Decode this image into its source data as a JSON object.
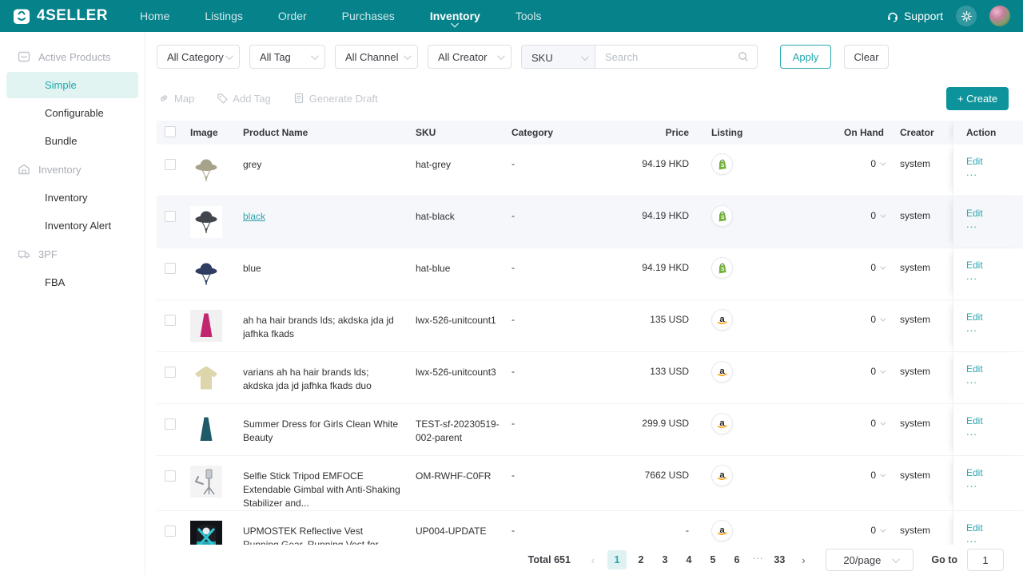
{
  "colors": {
    "brand_teal": "#06828b",
    "accent_teal": "#0c939b",
    "link_teal": "#2ba5ad",
    "active_bg": "#e2f4f2",
    "shopify_green": "#74b03c",
    "amazon_orange": "#ff9900"
  },
  "nav": {
    "brand": "4SELLER",
    "items": [
      {
        "label": "Home",
        "active": false
      },
      {
        "label": "Listings",
        "active": false
      },
      {
        "label": "Order",
        "active": false
      },
      {
        "label": "Purchases",
        "active": false
      },
      {
        "label": "Inventory",
        "active": true
      },
      {
        "label": "Tools",
        "active": false
      }
    ],
    "support": "Support"
  },
  "sidebar": {
    "sections": [
      {
        "label": "Active Products",
        "icon": "products-box-icon",
        "items": [
          {
            "label": "Simple",
            "active": true
          },
          {
            "label": "Configurable",
            "active": false
          },
          {
            "label": "Bundle",
            "active": false
          }
        ]
      },
      {
        "label": "Inventory",
        "icon": "warehouse-icon",
        "items": [
          {
            "label": "Inventory",
            "active": false
          },
          {
            "label": "Inventory Alert",
            "active": false
          }
        ]
      },
      {
        "label": "3PF",
        "icon": "fulfillment-truck-icon",
        "items": [
          {
            "label": "FBA",
            "active": false
          }
        ]
      }
    ]
  },
  "filters": {
    "category": "All Category",
    "tag": "All Tag",
    "channel": "All Channel",
    "creator": "All Creator",
    "search_field": "SKU",
    "search_placeholder": "Search",
    "apply": "Apply",
    "clear": "Clear"
  },
  "toolbar": {
    "map": "Map",
    "add_tag": "Add Tag",
    "generate_draft": "Generate Draft",
    "create": "+ Create"
  },
  "table": {
    "columns": {
      "image": "Image",
      "name": "Product Name",
      "sku": "SKU",
      "category": "Category",
      "price": "Price",
      "listing": "Listing",
      "on_hand": "On Hand",
      "creator": "Creator",
      "action": "Action"
    },
    "rows": [
      {
        "name": "grey",
        "name_link": false,
        "highlight": false,
        "sku": "hat-grey",
        "category": "-",
        "price": "94.19 HKD",
        "listing": "shopify",
        "on_hand": "0",
        "creator": "system",
        "action_edit": "Edit",
        "action_more": "...",
        "thumb": {
          "type": "hat",
          "color": "#a7a38a",
          "bg": "#ffffff"
        }
      },
      {
        "name": "black",
        "name_link": true,
        "highlight": true,
        "sku": "hat-black",
        "category": "-",
        "price": "94.19 HKD",
        "listing": "shopify",
        "on_hand": "0",
        "creator": "system",
        "action_edit": "Edit",
        "action_more": "...",
        "thumb": {
          "type": "hat",
          "color": "#41464c",
          "bg": "#ffffff"
        }
      },
      {
        "name": "blue",
        "name_link": false,
        "highlight": false,
        "sku": "hat-blue",
        "category": "-",
        "price": "94.19 HKD",
        "listing": "shopify",
        "on_hand": "0",
        "creator": "system",
        "action_edit": "Edit",
        "action_more": "...",
        "thumb": {
          "type": "hat",
          "color": "#2f3d63",
          "bg": "#ffffff"
        }
      },
      {
        "name": "ah ha hair brands lds; akdska jda jd jafhka fkads",
        "name_link": false,
        "highlight": false,
        "sku": "lwx-526-unitcount1",
        "category": "-",
        "price": "135 USD",
        "listing": "amazon",
        "on_hand": "0",
        "creator": "system",
        "action_edit": "Edit",
        "action_more": "...",
        "thumb": {
          "type": "dress",
          "color": "#c2266f",
          "bg": "#f1f1f1"
        }
      },
      {
        "name": "varians ah ha hair brands lds; akdska jda jd jafhka fkads duo",
        "name_link": false,
        "highlight": false,
        "sku": "lwx-526-unitcount3",
        "category": "-",
        "price": "133 USD",
        "listing": "amazon",
        "on_hand": "0",
        "creator": "system",
        "action_edit": "Edit",
        "action_more": "...",
        "thumb": {
          "type": "shirt",
          "color": "#ddd6ad",
          "bg": "#ffffff"
        }
      },
      {
        "name": "Summer Dress for Girls Clean White Beauty",
        "name_link": false,
        "highlight": false,
        "sku": "TEST-sf-20230519-002-parent",
        "category": "-",
        "price": "299.9 USD",
        "listing": "amazon",
        "on_hand": "0",
        "creator": "system",
        "action_edit": "Edit",
        "action_more": "...",
        "thumb": {
          "type": "dress",
          "color": "#1e5a68",
          "bg": "#ffffff"
        }
      },
      {
        "name": "Selfie Stick Tripod EMFOCE Extendable Gimbal with Anti-Shaking Stabilizer and...",
        "name_link": false,
        "highlight": false,
        "sku": "OM-RWHF-C0FR",
        "category": "-",
        "price": "7662 USD",
        "listing": "amazon",
        "on_hand": "0",
        "creator": "system",
        "action_edit": "Edit",
        "action_more": "...",
        "thumb": {
          "type": "selfie",
          "color": "#8d939a",
          "bg": "#f4f4f4"
        }
      },
      {
        "name": "UPMOSTEK Reflective Vest Running Gear, Running Vest for Runners, High Visibility...",
        "name_link": false,
        "highlight": false,
        "sku": "UP004-UPDATE",
        "category": "-",
        "price": "-",
        "listing": "amazon",
        "on_hand": "0",
        "creator": "system",
        "action_edit": "Edit",
        "action_more": "...",
        "thumb": {
          "type": "vest",
          "color": "#1c1e24",
          "accent": "#2cc8d6",
          "bg": "#ffffff"
        }
      }
    ]
  },
  "pagination": {
    "total": "Total 651",
    "pages": [
      "1",
      "2",
      "3",
      "4",
      "5",
      "6",
      "...",
      "33"
    ],
    "active": "1",
    "page_size": "20/page",
    "goto_label": "Go to",
    "goto_value": "1"
  }
}
